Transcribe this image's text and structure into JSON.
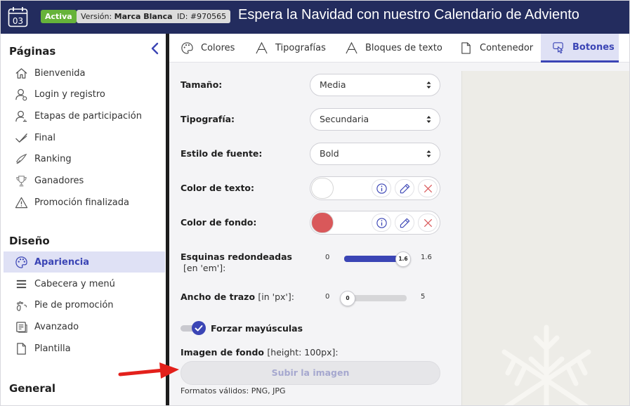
{
  "header": {
    "day_number": "03",
    "status_badge": "Activa",
    "version_label": "Versión:",
    "version_value": "Marca Blanca",
    "id_label": "ID: #970565",
    "title": "Espera la Navidad con nuestro Calendario de Adviento"
  },
  "sidebar": {
    "section_pages": "Páginas",
    "pages": [
      {
        "label": "Bienvenida",
        "icon": "home-icon"
      },
      {
        "label": "Login y registro",
        "icon": "user-icon"
      },
      {
        "label": "Etapas de participación",
        "icon": "user-steps-icon"
      },
      {
        "label": "Final",
        "icon": "check-icon"
      },
      {
        "label": "Ranking",
        "icon": "ranking-icon"
      },
      {
        "label": "Ganadores",
        "icon": "trophy-icon"
      },
      {
        "label": "Promoción finalizada",
        "icon": "warning-icon"
      }
    ],
    "section_design": "Diseño",
    "design": [
      {
        "label": "Apariencia",
        "icon": "palette-icon",
        "active": true
      },
      {
        "label": "Cabecera y menú",
        "icon": "menu-icon"
      },
      {
        "label": "Pie de promoción",
        "icon": "footprint-icon"
      },
      {
        "label": "Avanzado",
        "icon": "advanced-icon"
      },
      {
        "label": "Plantilla",
        "icon": "document-icon"
      }
    ],
    "section_general": "General"
  },
  "tabs": [
    {
      "label": "Colores",
      "icon": "palette-icon"
    },
    {
      "label": "Tipografías",
      "icon": "typography-icon"
    },
    {
      "label": "Bloques de texto",
      "icon": "typography-icon"
    },
    {
      "label": "Contenedor",
      "icon": "document-icon"
    },
    {
      "label": "Botones",
      "icon": "pointer-icon",
      "active": true
    }
  ],
  "form": {
    "size_label": "Tamaño:",
    "size_value": "Media",
    "font_label": "Tipografía:",
    "font_value": "Secundaria",
    "style_label": "Estilo de fuente:",
    "style_value": "Bold",
    "text_color_label": "Color de texto:",
    "text_color": "#ffffff",
    "bg_color_label": "Color de fondo:",
    "bg_color": "#d9585a",
    "radius_label": "Esquinas redondeadas",
    "radius_unit": "[en 'em']:",
    "radius_min": "0",
    "radius_max": "1.6",
    "radius_value": "1.6",
    "radius_fraction": 1.0,
    "stroke_label": "Ancho de trazo",
    "stroke_unit": "[in 'px']:",
    "stroke_min": "0",
    "stroke_max": "5",
    "stroke_value": "0",
    "stroke_fraction": 0.0,
    "uppercase_label": "Forzar mayúsculas",
    "uppercase_on": true,
    "bg_image_label": "Imagen de fondo",
    "bg_image_hint": "[height: 100px]:",
    "upload_label": "Subir la imagen",
    "formats": "Formatos válidos: PNG, JPG"
  },
  "colors": {
    "header_bg": "#232c5e",
    "accent": "#3b45b5",
    "active_bg": "#dfe1f5",
    "arrow": "#e3201b"
  }
}
